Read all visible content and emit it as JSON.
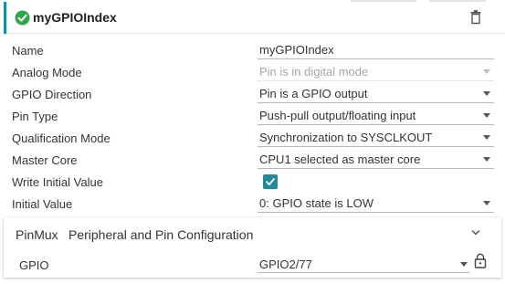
{
  "header": {
    "title": "myGPIOIndex",
    "status_icon": "check-circle-icon",
    "delete_icon": "trash-icon",
    "accent_color": "#1f8b9a",
    "status_color": "#2aa84a"
  },
  "fields": [
    {
      "label": "Name",
      "value": "myGPIOIndex",
      "kind": "text",
      "disabled": false
    },
    {
      "label": "Analog Mode",
      "value": "Pin is in digital mode",
      "kind": "select",
      "disabled": true
    },
    {
      "label": "GPIO Direction",
      "value": "Pin is a GPIO output",
      "kind": "select",
      "disabled": false
    },
    {
      "label": "Pin Type",
      "value": "Push-pull output/floating input",
      "kind": "select",
      "disabled": false
    },
    {
      "label": "Qualification Mode",
      "value": "Synchronization to SYSCLKOUT",
      "kind": "select",
      "disabled": false
    },
    {
      "label": "Master Core",
      "value": "CPU1 selected as master core",
      "kind": "select",
      "disabled": false
    },
    {
      "label": "Write Initial Value",
      "value": "",
      "kind": "checkbox",
      "checked": true
    },
    {
      "label": "Initial Value",
      "value": "0: GPIO state is LOW",
      "kind": "select",
      "disabled": false
    }
  ],
  "pinmux": {
    "title": "PinMux",
    "subtitle": "Peripheral and Pin Configuration",
    "expand_icon": "chevron-down-icon",
    "gpio_label": "GPIO",
    "gpio_value": "GPIO2/77",
    "lock_icon": "lock-icon"
  }
}
